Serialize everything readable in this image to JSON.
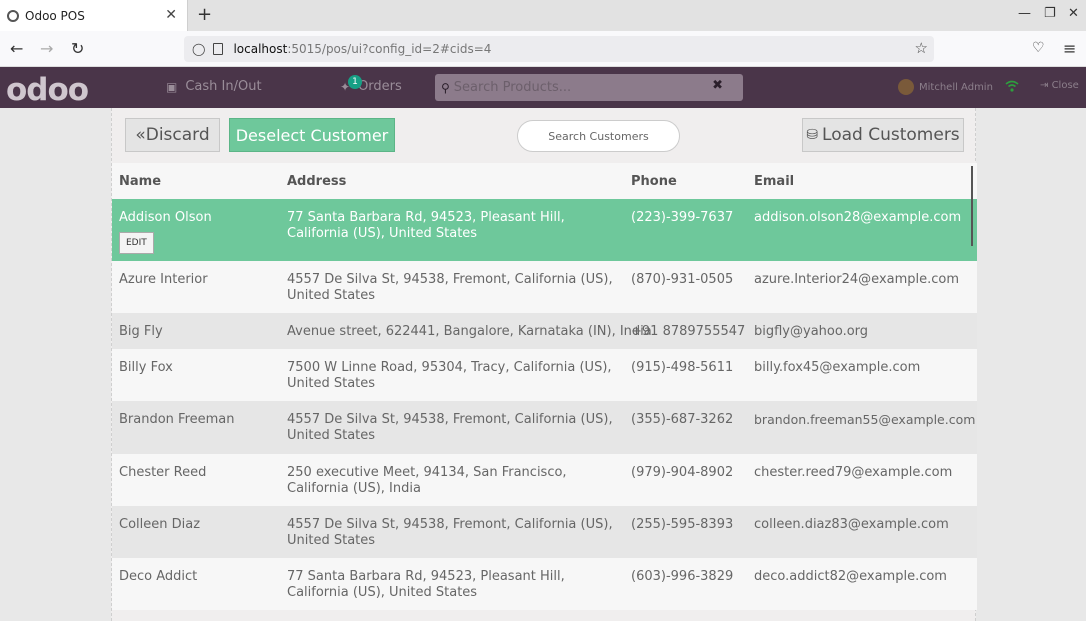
{
  "browser": {
    "tab_title": "Odoo POS",
    "url_host": "localhost",
    "url_path": ":5015/pos/ui?config_id=2#cids=4"
  },
  "pos": {
    "logo": "odoo",
    "cash_label": "Cash In/Out",
    "orders_label": "Orders",
    "orders_count": "1",
    "search_placeholder": "Search Products...",
    "user_name": "Mitchell Admin",
    "close_label": "Close"
  },
  "toolbar": {
    "discard_label": "Discard",
    "deselect_label": "Deselect Customer",
    "search_placeholder": "Search Customers",
    "load_label": "Load Customers"
  },
  "table": {
    "headers": [
      "Name",
      "Address",
      "Phone",
      "Email"
    ],
    "edit_label": "EDIT",
    "rows": [
      {
        "name": "Addison Olson",
        "address": "77 Santa Barbara Rd, 94523, Pleasant Hill, California (US), United States",
        "phone": "(223)-399-7637",
        "email": "addison.olson28@example.com"
      },
      {
        "name": "Azure Interior",
        "address": "4557 De Silva St, 94538, Fremont, California (US), United States",
        "phone": "(870)-931-0505",
        "email": "azure.Interior24@example.com"
      },
      {
        "name": "Big Fly",
        "address": "Avenue street, 622441, Bangalore, Karnataka (IN), India",
        "phone": "+91 8789755547",
        "email": "bigfly@yahoo.org"
      },
      {
        "name": "Billy Fox",
        "address": "7500 W Linne Road, 95304, Tracy, California (US), United States",
        "phone": "(915)-498-5611",
        "email": "billy.fox45@example.com"
      },
      {
        "name": "Brandon Freeman",
        "address": "4557 De Silva St, 94538, Fremont, California (US), United States",
        "phone": "(355)-687-3262",
        "email": "brandon.freeman55@example.com"
      },
      {
        "name": "Chester Reed",
        "address": "250 executive Meet, 94134, San Francisco, California (US), India",
        "phone": "(979)-904-8902",
        "email": "chester.reed79@example.com"
      },
      {
        "name": "Colleen Diaz",
        "address": "4557 De Silva St, 94538, Fremont, California (US), United States",
        "phone": "(255)-595-8393",
        "email": "colleen.diaz83@example.com"
      },
      {
        "name": "Deco Addict",
        "address": "77 Santa Barbara Rd, 94523, Pleasant Hill, California (US), United States",
        "phone": "(603)-996-3829",
        "email": "deco.addict82@example.com"
      }
    ]
  }
}
